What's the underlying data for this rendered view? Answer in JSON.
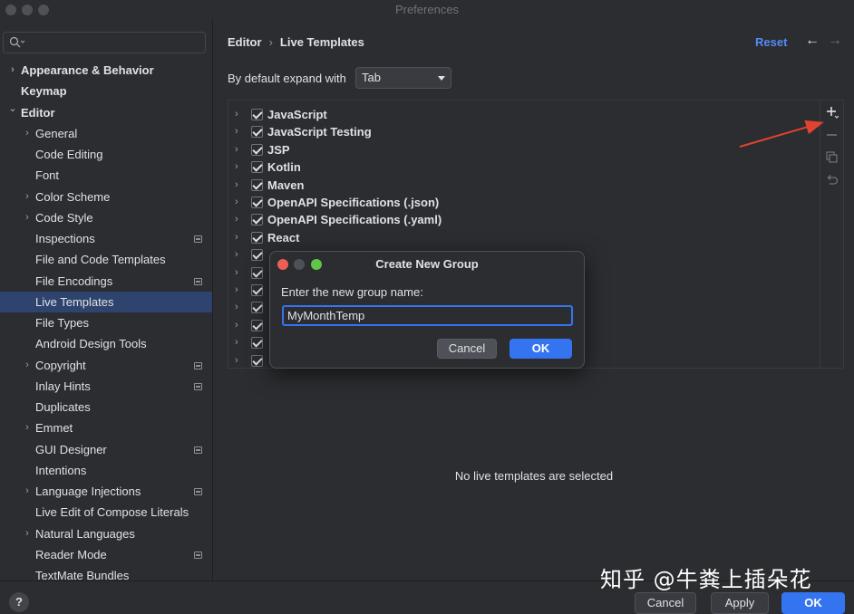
{
  "window": {
    "title": "Preferences"
  },
  "search": {
    "placeholder": ""
  },
  "sidebar": {
    "items": [
      {
        "label": "Appearance & Behavior",
        "indent": 0,
        "chevron": true,
        "bold": true
      },
      {
        "label": "Keymap",
        "indent": 0,
        "chevron": false,
        "bold": true
      },
      {
        "label": "Editor",
        "indent": 0,
        "chevron": true,
        "expanded": true,
        "bold": true
      },
      {
        "label": "General",
        "indent": 1,
        "chevron": true
      },
      {
        "label": "Code Editing",
        "indent": 1,
        "chevron": false
      },
      {
        "label": "Font",
        "indent": 1,
        "chevron": false
      },
      {
        "label": "Color Scheme",
        "indent": 1,
        "chevron": true
      },
      {
        "label": "Code Style",
        "indent": 1,
        "chevron": true
      },
      {
        "label": "Inspections",
        "indent": 1,
        "chevron": false,
        "modified": true
      },
      {
        "label": "File and Code Templates",
        "indent": 1,
        "chevron": false
      },
      {
        "label": "File Encodings",
        "indent": 1,
        "chevron": false,
        "modified": true
      },
      {
        "label": "Live Templates",
        "indent": 1,
        "chevron": false,
        "selected": true
      },
      {
        "label": "File Types",
        "indent": 1,
        "chevron": false
      },
      {
        "label": "Android Design Tools",
        "indent": 1,
        "chevron": false
      },
      {
        "label": "Copyright",
        "indent": 1,
        "chevron": true,
        "modified": true
      },
      {
        "label": "Inlay Hints",
        "indent": 1,
        "chevron": false,
        "modified": true
      },
      {
        "label": "Duplicates",
        "indent": 1,
        "chevron": false
      },
      {
        "label": "Emmet",
        "indent": 1,
        "chevron": true
      },
      {
        "label": "GUI Designer",
        "indent": 1,
        "chevron": false,
        "modified": true
      },
      {
        "label": "Intentions",
        "indent": 1,
        "chevron": false
      },
      {
        "label": "Language Injections",
        "indent": 1,
        "chevron": true,
        "modified": true
      },
      {
        "label": "Live Edit of Compose Literals",
        "indent": 1,
        "chevron": false
      },
      {
        "label": "Natural Languages",
        "indent": 1,
        "chevron": true
      },
      {
        "label": "Reader Mode",
        "indent": 1,
        "chevron": false,
        "modified": true
      },
      {
        "label": "TextMate Bundles",
        "indent": 1,
        "chevron": false
      }
    ]
  },
  "main": {
    "breadcrumb": [
      "Editor",
      "Live Templates"
    ],
    "breadcrumb_sep": "›",
    "reset_label": "Reset",
    "back_arrow": "←",
    "forward_arrow": "→",
    "expand_label": "By default expand with",
    "expand_value": "Tab",
    "template_groups": [
      {
        "name": "JavaScript",
        "checked": true
      },
      {
        "name": "JavaScript Testing",
        "checked": true
      },
      {
        "name": "JSP",
        "checked": true
      },
      {
        "name": "Kotlin",
        "checked": true
      },
      {
        "name": "Maven",
        "checked": true
      },
      {
        "name": "OpenAPI Specifications (.json)",
        "checked": true
      },
      {
        "name": "OpenAPI Specifications (.yaml)",
        "checked": true
      },
      {
        "name": "React",
        "checked": true
      }
    ],
    "empty_message": "No live templates are selected"
  },
  "dialog": {
    "title": "Create New Group",
    "prompt": "Enter the new group name:",
    "input_value": "MyMonthTemp",
    "cancel_label": "Cancel",
    "ok_label": "OK"
  },
  "footer": {
    "help_label": "?",
    "cancel_label": "Cancel",
    "apply_label": "Apply",
    "ok_label": "OK"
  },
  "watermark": {
    "text": "知乎 @牛粪上插朵花"
  },
  "colors": {
    "accent": "#3574f0",
    "selection": "#2e436e",
    "annotation_arrow": "#e0442e",
    "link": "#548af7"
  }
}
